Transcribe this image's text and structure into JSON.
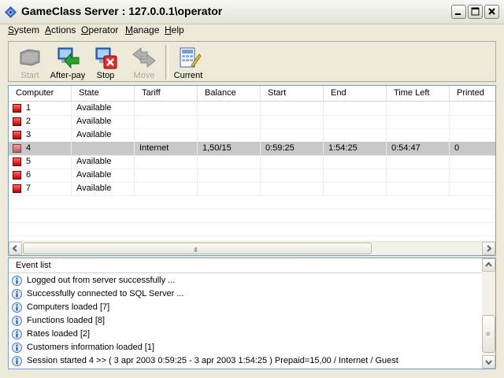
{
  "window": {
    "title": "GameClass Server : 127.0.0.1\\operator"
  },
  "menu": [
    {
      "label": "System",
      "accel": "S",
      "rest": "ystem"
    },
    {
      "label": "Actions",
      "accel": "A",
      "rest": "ctions"
    },
    {
      "label": "Operator",
      "accel": "O",
      "rest": "perator"
    },
    {
      "label": "Manage",
      "accel": "M",
      "rest": "anage"
    },
    {
      "label": "Help",
      "accel": "H",
      "rest": "elp"
    }
  ],
  "toolbar": {
    "start_label": "Start",
    "afterpay_label": "After-pay",
    "stop_label": "Stop",
    "move_label": "Move",
    "current_label": "Current"
  },
  "grid": {
    "columns": [
      "Computer",
      "State",
      "Tariff",
      "Balance",
      "Start",
      "End",
      "Time Left",
      "Printed"
    ],
    "rows": [
      {
        "computer": "1",
        "state": "Available",
        "tariff": "",
        "balance": "",
        "start": "",
        "end": "",
        "time_left": "",
        "printed": ""
      },
      {
        "computer": "2",
        "state": "Available",
        "tariff": "",
        "balance": "",
        "start": "",
        "end": "",
        "time_left": "",
        "printed": ""
      },
      {
        "computer": "3",
        "state": "Available",
        "tariff": "",
        "balance": "",
        "start": "",
        "end": "",
        "time_left": "",
        "printed": ""
      },
      {
        "computer": "4",
        "state": "",
        "tariff": "Internet",
        "balance": "1,50/15",
        "start": "0:59:25",
        "end": "1:54:25",
        "time_left": "0:54:47",
        "printed": "0"
      },
      {
        "computer": "5",
        "state": "Available",
        "tariff": "",
        "balance": "",
        "start": "",
        "end": "",
        "time_left": "",
        "printed": ""
      },
      {
        "computer": "6",
        "state": "Available",
        "tariff": "",
        "balance": "",
        "start": "",
        "end": "",
        "time_left": "",
        "printed": ""
      },
      {
        "computer": "7",
        "state": "Available",
        "tariff": "",
        "balance": "",
        "start": "",
        "end": "",
        "time_left": "",
        "printed": ""
      }
    ],
    "scroll_grip": "III"
  },
  "events": {
    "header": "Event list",
    "items": [
      "Logged out from server successfully ...",
      "Successfully connected to SQL Server  ...",
      "Computers loaded [7]",
      "Functions loaded [8]",
      "Rates loaded [2]",
      "Customers information loaded [1]",
      "Session started 4 >> ( 3 apr 2003 0:59:25 - 3 apr 2003 1:54:25 ) Prepaid=15,00 / Internet / Guest"
    ],
    "scroll_grip": "≡"
  },
  "colors": {
    "computer_icon": "#c10000",
    "selection": "#c8c8c8",
    "border": "#7f9db9"
  }
}
